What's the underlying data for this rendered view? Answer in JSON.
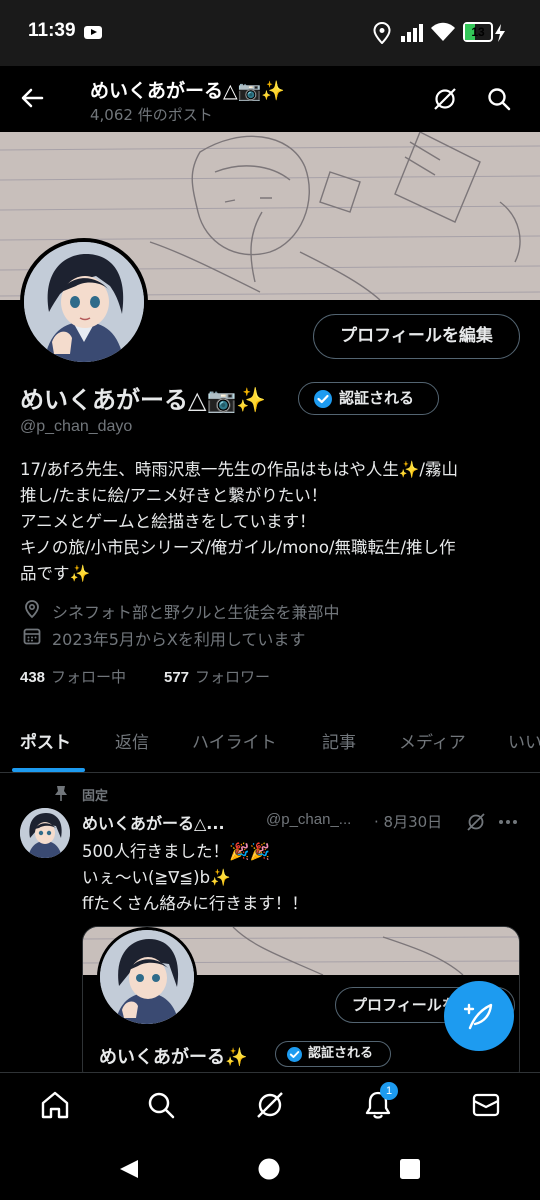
{
  "status_bar": {
    "time": "11:39",
    "battery": "13"
  },
  "header": {
    "name": "めいくあがーる△📷✨",
    "post_count": "4,062 件のポスト"
  },
  "profile": {
    "edit_button": "プロフィールを編集",
    "display_name": "めいくあがーる△📷✨",
    "verify_button": "認証される",
    "handle": "@p_chan_dayo",
    "bio_lines": [
      "17/あfろ先生、時雨沢恵一先生の作品はもはや人生✨/霧山",
      "推し/たまに絵/アニメ好きと繋がりたい！",
      "アニメとゲームと絵描きをしています！",
      "キノの旅/小市民シリーズ/俺ガイル/mono/無職転生/推し作",
      "品です✨"
    ],
    "location": "シネフォト部と野クルと生徒会を兼部中",
    "joined": "2023年5月からXを利用しています",
    "following_count": "438",
    "following_label": "フォロー中",
    "followers_count": "577",
    "followers_label": "フォロワー"
  },
  "tabs": [
    "ポスト",
    "返信",
    "ハイライト",
    "記事",
    "メディア",
    "いい"
  ],
  "pinned_post": {
    "pinned_label": "固定",
    "name": "めいくあがーる△...",
    "handle": "@p_chan_...",
    "date": "· 8月30日",
    "lines": [
      "500人行きました！🎉🎉",
      "いぇ〜い(≧∇≦)b✨",
      "ffたくさん絡みに行きます！！"
    ],
    "embed": {
      "edit_button": "プロフィールを",
      "name": "めいくあがーる✨",
      "verify_button": "認証される"
    }
  },
  "bottom_nav": {
    "notification_badge": "1"
  },
  "colors": {
    "accent": "#1d9bf0",
    "background": "#000000",
    "muted": "#71767b",
    "text": "#e7e9ea"
  }
}
